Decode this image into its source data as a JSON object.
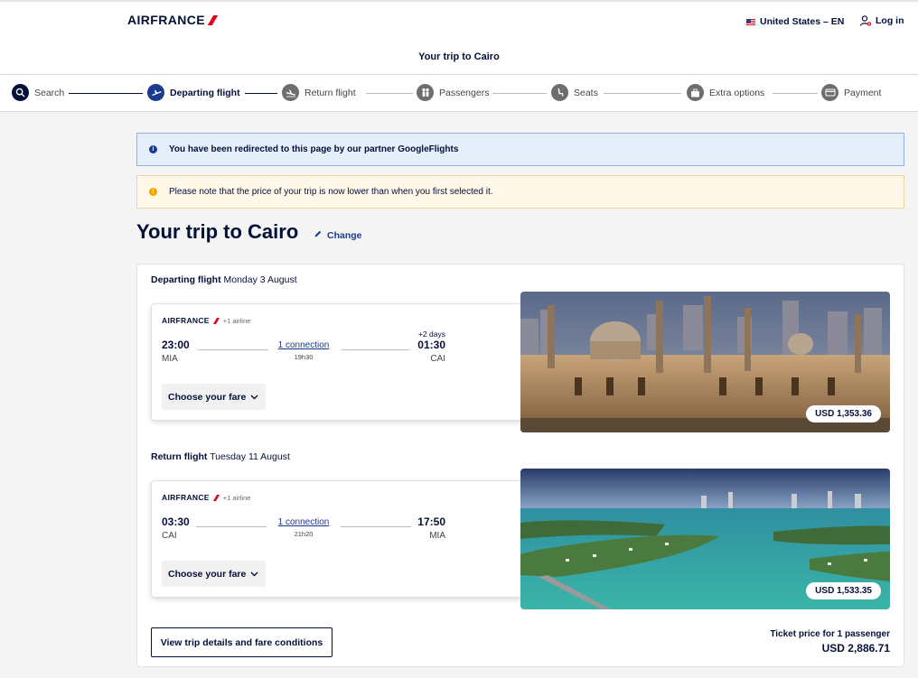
{
  "header": {
    "logo_text": "AIRFRANCE",
    "locale": "United States – EN",
    "login": "Log in",
    "title": "Your trip to Cairo"
  },
  "stepper": {
    "steps": [
      {
        "label": "Search"
      },
      {
        "label": "Departing flight"
      },
      {
        "label": "Return flight"
      },
      {
        "label": "Passengers"
      },
      {
        "label": "Seats"
      },
      {
        "label": "Extra options"
      },
      {
        "label": "Payment"
      }
    ]
  },
  "notices": {
    "info": "You have been redirected to this page by our partner GoogleFlights",
    "warning": "Please note that the price of your trip is now lower than when you first selected it."
  },
  "trip": {
    "title": "Your trip to Cairo",
    "change_label": "Change"
  },
  "departing": {
    "label": "Departing flight",
    "date": "Monday 3 August",
    "airline": "AIRFRANCE",
    "airline_extra": "+1 airline",
    "dep_time": "23:00",
    "dep_code": "MIA",
    "arr_time": "01:30",
    "arr_code": "CAI",
    "day_offset": "+2 days",
    "connection": "1 connection",
    "duration": "19h30",
    "fare_button": "Choose your fare",
    "price": "USD 1,353.36"
  },
  "return": {
    "label": "Return flight",
    "date": "Tuesday 11 August",
    "airline": "AIRFRANCE",
    "airline_extra": "+1 airline",
    "dep_time": "03:30",
    "dep_code": "CAI",
    "arr_time": "17:50",
    "arr_code": "MIA",
    "connection": "1 connection",
    "duration": "21h20",
    "fare_button": "Choose your fare",
    "price": "USD 1,533.35"
  },
  "footer": {
    "details_button": "View trip details and fare conditions",
    "ticket_label": "Ticket price for 1 passenger",
    "ticket_total": "USD 2,886.71"
  },
  "colors": {
    "brand_navy": "#051039",
    "brand_red": "#e2001a",
    "link_blue": "#1a3b8f"
  }
}
